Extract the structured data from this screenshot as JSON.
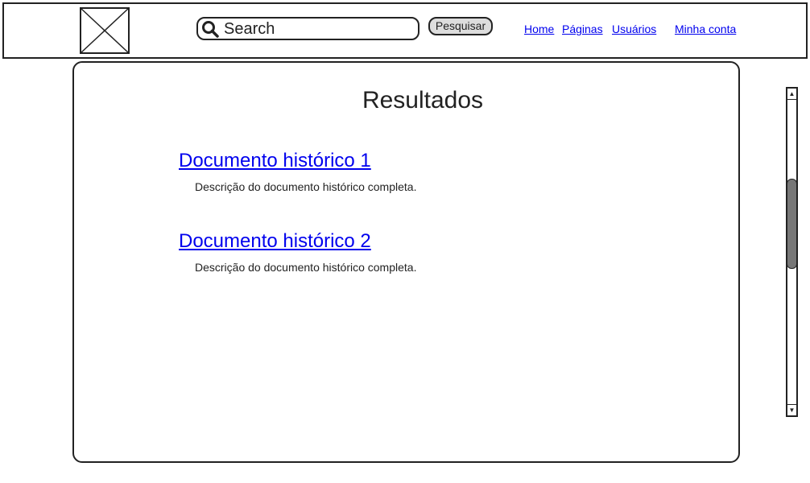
{
  "header": {
    "logo_icon": "image-placeholder-icon",
    "search": {
      "icon": "search-icon",
      "value": "",
      "placeholder": "Search"
    },
    "search_button_label": "Pesquisar",
    "nav": {
      "home": "Home",
      "pages": "Páginas",
      "users": "Usuários",
      "account": "Minha conta"
    }
  },
  "main": {
    "title": "Resultados",
    "results": [
      {
        "title": "Documento histórico 1",
        "description": "Descrição do documento histórico completa."
      },
      {
        "title": "Documento histórico 2",
        "description": "Descrição do documento histórico completa."
      }
    ]
  },
  "scrollbar": {
    "up_icon": "▲",
    "down_icon": "▼",
    "position": 0.37
  },
  "colors": {
    "link": "#0000ee",
    "border": "#222222",
    "button_bg": "#dddddd",
    "scroll_thumb": "#777777"
  }
}
